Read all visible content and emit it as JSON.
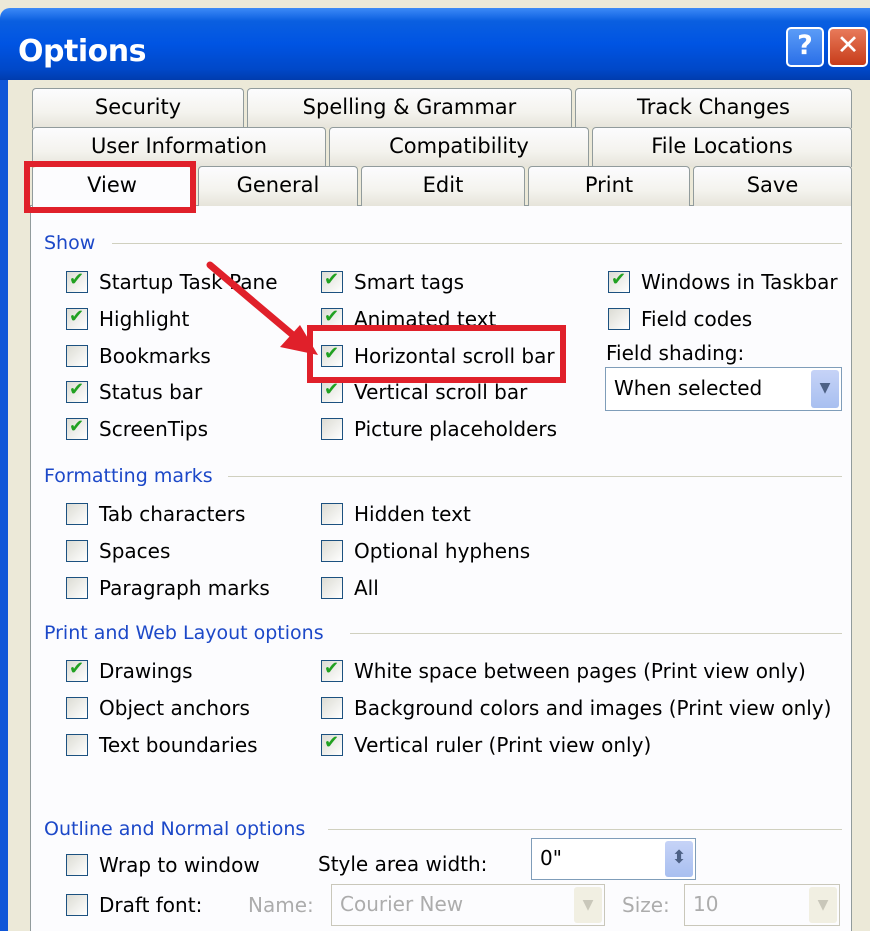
{
  "window": {
    "title": "Options",
    "help_glyph": "?",
    "close_glyph": "✕"
  },
  "tabs_row1": [
    "Security",
    "Spelling & Grammar",
    "Track Changes"
  ],
  "tabs_row2": [
    "User Information",
    "Compatibility",
    "File Locations"
  ],
  "tabs_row3": [
    "View",
    "General",
    "Edit",
    "Print",
    "Save"
  ],
  "active_tab": "View",
  "show": {
    "heading": "Show",
    "col1": [
      {
        "label": "Startup Task Pane",
        "checked": true
      },
      {
        "label": "Highlight",
        "checked": true
      },
      {
        "label": "Bookmarks",
        "checked": false
      },
      {
        "label": "Status bar",
        "checked": true
      },
      {
        "label": "ScreenTips",
        "checked": true
      }
    ],
    "col2": [
      {
        "label": "Smart tags",
        "checked": true
      },
      {
        "label": "Animated text",
        "checked": true
      },
      {
        "label": "Horizontal scroll bar",
        "checked": true
      },
      {
        "label": "Vertical scroll bar",
        "checked": true
      },
      {
        "label": "Picture placeholders",
        "checked": false
      }
    ],
    "col3": [
      {
        "label": "Windows in Taskbar",
        "checked": true
      },
      {
        "label": "Field codes",
        "checked": false
      }
    ],
    "field_shading_label": "Field shading:",
    "field_shading_value": "When selected",
    "dropdown_glyph": "▼"
  },
  "formatting_marks": {
    "heading": "Formatting marks",
    "col1": [
      {
        "label": "Tab characters",
        "checked": false
      },
      {
        "label": "Spaces",
        "checked": false
      },
      {
        "label": "Paragraph marks",
        "checked": false
      }
    ],
    "col2": [
      {
        "label": "Hidden text",
        "checked": false
      },
      {
        "label": "Optional hyphens",
        "checked": false
      },
      {
        "label": "All",
        "checked": false
      }
    ]
  },
  "print_web": {
    "heading": "Print and Web Layout options",
    "col1": [
      {
        "label": "Drawings",
        "checked": true
      },
      {
        "label": "Object anchors",
        "checked": false
      },
      {
        "label": "Text boundaries",
        "checked": false
      }
    ],
    "col2": [
      {
        "label": "White space between pages (Print view only)",
        "checked": true
      },
      {
        "label": "Background colors and images (Print view only)",
        "checked": false
      },
      {
        "label": "Vertical ruler (Print view only)",
        "checked": true
      }
    ]
  },
  "outline": {
    "heading": "Outline and Normal options",
    "wrap_to_window": {
      "label": "Wrap to window",
      "checked": false
    },
    "draft_font": {
      "label": "Draft font:",
      "checked": false
    },
    "style_area_label": "Style area width:",
    "style_area_value": "0\"",
    "spinner_glyph": "⬍",
    "name_label": "Name:",
    "name_value": "Courier New",
    "size_label": "Size:",
    "size_value": "10"
  },
  "colors": {
    "annotation": "#e0202a",
    "title_bar": "#0054e3",
    "group_heading": "#1c48c8"
  }
}
